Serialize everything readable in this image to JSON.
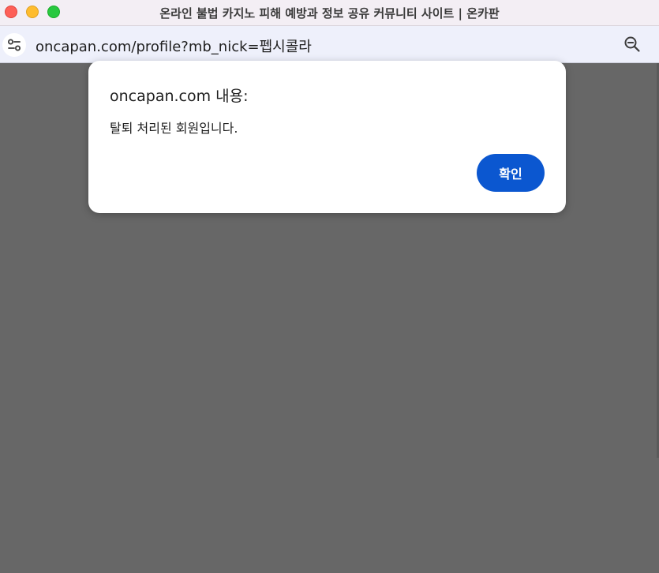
{
  "window": {
    "title": "온라인 불법 카지노 피해 예방과 정보 공유 커뮤니티 사이트 | 온카판"
  },
  "toolbar": {
    "url": "oncapan.com/profile?mb_nick=펩시콜라",
    "site_info_icon": "tune-icon",
    "zoom_icon": "zoom-out-icon"
  },
  "dialog": {
    "title": "oncapan.com 내용:",
    "message": "탈퇴 처리된 회원입니다.",
    "ok_label": "확인"
  },
  "colors": {
    "page_background": "#676767",
    "accent": "#0b57d0",
    "titlebar": "#f3eef4",
    "toolbar": "#eef0fb"
  }
}
